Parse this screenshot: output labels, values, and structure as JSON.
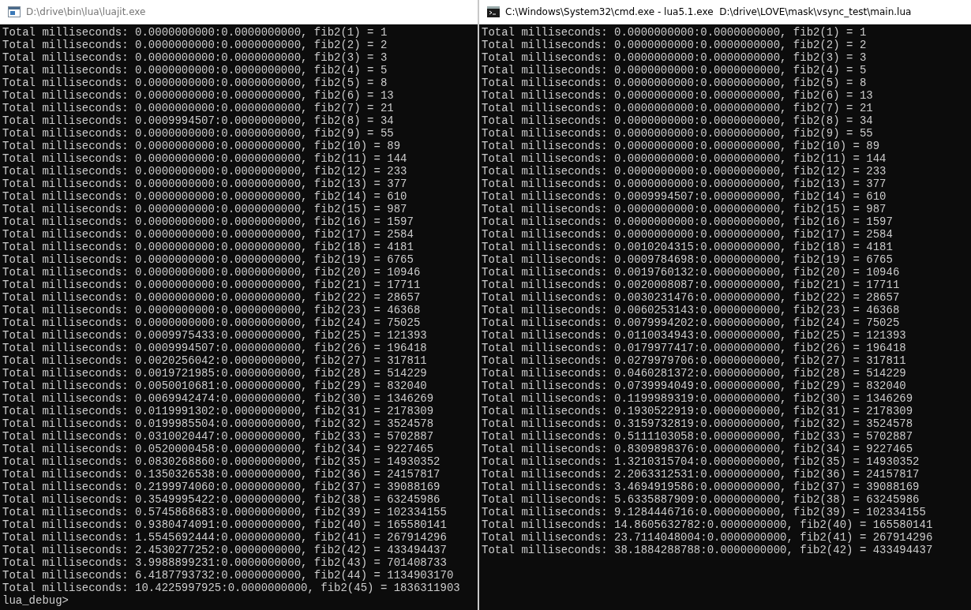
{
  "windows": [
    {
      "kind": "app",
      "title": "D:\\drive\\bin\\lua\\luajit.exe",
      "lines": [
        "Total milliseconds: 0.0000000000:0.0000000000, fib2(1) = 1",
        "Total milliseconds: 0.0000000000:0.0000000000, fib2(2) = 2",
        "Total milliseconds: 0.0000000000:0.0000000000, fib2(3) = 3",
        "Total milliseconds: 0.0000000000:0.0000000000, fib2(4) = 5",
        "Total milliseconds: 0.0000000000:0.0000000000, fib2(5) = 8",
        "Total milliseconds: 0.0000000000:0.0000000000, fib2(6) = 13",
        "Total milliseconds: 0.0000000000:0.0000000000, fib2(7) = 21",
        "Total milliseconds: 0.0009994507:0.0000000000, fib2(8) = 34",
        "Total milliseconds: 0.0000000000:0.0000000000, fib2(9) = 55",
        "Total milliseconds: 0.0000000000:0.0000000000, fib2(10) = 89",
        "Total milliseconds: 0.0000000000:0.0000000000, fib2(11) = 144",
        "Total milliseconds: 0.0000000000:0.0000000000, fib2(12) = 233",
        "Total milliseconds: 0.0000000000:0.0000000000, fib2(13) = 377",
        "Total milliseconds: 0.0000000000:0.0000000000, fib2(14) = 610",
        "Total milliseconds: 0.0000000000:0.0000000000, fib2(15) = 987",
        "Total milliseconds: 0.0000000000:0.0000000000, fib2(16) = 1597",
        "Total milliseconds: 0.0000000000:0.0000000000, fib2(17) = 2584",
        "Total milliseconds: 0.0000000000:0.0000000000, fib2(18) = 4181",
        "Total milliseconds: 0.0000000000:0.0000000000, fib2(19) = 6765",
        "Total milliseconds: 0.0000000000:0.0000000000, fib2(20) = 10946",
        "Total milliseconds: 0.0000000000:0.0000000000, fib2(21) = 17711",
        "Total milliseconds: 0.0000000000:0.0000000000, fib2(22) = 28657",
        "Total milliseconds: 0.0000000000:0.0000000000, fib2(23) = 46368",
        "Total milliseconds: 0.0000000000:0.0000000000, fib2(24) = 75025",
        "Total milliseconds: 0.0009975433:0.0000000000, fib2(25) = 121393",
        "Total milliseconds: 0.0009994507:0.0000000000, fib2(26) = 196418",
        "Total milliseconds: 0.0020256042:0.0000000000, fib2(27) = 317811",
        "Total milliseconds: 0.0019721985:0.0000000000, fib2(28) = 514229",
        "Total milliseconds: 0.0050010681:0.0000000000, fib2(29) = 832040",
        "Total milliseconds: 0.0069942474:0.0000000000, fib2(30) = 1346269",
        "Total milliseconds: 0.0119991302:0.0000000000, fib2(31) = 2178309",
        "Total milliseconds: 0.0199985504:0.0000000000, fib2(32) = 3524578",
        "Total milliseconds: 0.0310020447:0.0000000000, fib2(33) = 5702887",
        "Total milliseconds: 0.0520000458:0.0000000000, fib2(34) = 9227465",
        "Total milliseconds: 0.0830268860:0.0000000000, fib2(35) = 14930352",
        "Total milliseconds: 0.1350326538:0.0000000000, fib2(36) = 24157817",
        "Total milliseconds: 0.2199974060:0.0000000000, fib2(37) = 39088169",
        "Total milliseconds: 0.3549995422:0.0000000000, fib2(38) = 63245986",
        "Total milliseconds: 0.5745868683:0.0000000000, fib2(39) = 102334155",
        "Total milliseconds: 0.9380474091:0.0000000000, fib2(40) = 165580141",
        "Total milliseconds: 1.5545692444:0.0000000000, fib2(41) = 267914296",
        "Total milliseconds: 2.4530277252:0.0000000000, fib2(42) = 433494437",
        "Total milliseconds: 3.9988899231:0.0000000000, fib2(43) = 701408733",
        "Total milliseconds: 6.4187793732:0.0000000000, fib2(44) = 1134903170",
        "Total milliseconds: 10.4225997925:0.0000000000, fib2(45) = 1836311903",
        "lua_debug>"
      ]
    },
    {
      "kind": "cmd",
      "title": "C:\\Windows\\System32\\cmd.exe - lua5.1.exe  D:\\drive\\LOVE\\mask\\vsync_test\\main.lua",
      "lines": [
        "Total milliseconds: 0.0000000000:0.0000000000, fib2(1) = 1",
        "Total milliseconds: 0.0000000000:0.0000000000, fib2(2) = 2",
        "Total milliseconds: 0.0000000000:0.0000000000, fib2(3) = 3",
        "Total milliseconds: 0.0000000000:0.0000000000, fib2(4) = 5",
        "Total milliseconds: 0.0000000000:0.0000000000, fib2(5) = 8",
        "Total milliseconds: 0.0000000000:0.0000000000, fib2(6) = 13",
        "Total milliseconds: 0.0000000000:0.0000000000, fib2(7) = 21",
        "Total milliseconds: 0.0000000000:0.0000000000, fib2(8) = 34",
        "Total milliseconds: 0.0000000000:0.0000000000, fib2(9) = 55",
        "Total milliseconds: 0.0000000000:0.0000000000, fib2(10) = 89",
        "Total milliseconds: 0.0000000000:0.0000000000, fib2(11) = 144",
        "Total milliseconds: 0.0000000000:0.0000000000, fib2(12) = 233",
        "Total milliseconds: 0.0000000000:0.0000000000, fib2(13) = 377",
        "Total milliseconds: 0.0009994507:0.0000000000, fib2(14) = 610",
        "Total milliseconds: 0.0000000000:0.0000000000, fib2(15) = 987",
        "Total milliseconds: 0.0000000000:0.0000000000, fib2(16) = 1597",
        "Total milliseconds: 0.0000000000:0.0000000000, fib2(17) = 2584",
        "Total milliseconds: 0.0010204315:0.0000000000, fib2(18) = 4181",
        "Total milliseconds: 0.0009784698:0.0000000000, fib2(19) = 6765",
        "Total milliseconds: 0.0019760132:0.0000000000, fib2(20) = 10946",
        "Total milliseconds: 0.0020008087:0.0000000000, fib2(21) = 17711",
        "Total milliseconds: 0.0030231476:0.0000000000, fib2(22) = 28657",
        "Total milliseconds: 0.0060253143:0.0000000000, fib2(23) = 46368",
        "Total milliseconds: 0.0079994202:0.0000000000, fib2(24) = 75025",
        "Total milliseconds: 0.0110034943:0.0000000000, fib2(25) = 121393",
        "Total milliseconds: 0.0179977417:0.0000000000, fib2(26) = 196418",
        "Total milliseconds: 0.0279979706:0.0000000000, fib2(27) = 317811",
        "Total milliseconds: 0.0460281372:0.0000000000, fib2(28) = 514229",
        "Total milliseconds: 0.0739994049:0.0000000000, fib2(29) = 832040",
        "Total milliseconds: 0.1199989319:0.0000000000, fib2(30) = 1346269",
        "Total milliseconds: 0.1930522919:0.0000000000, fib2(31) = 2178309",
        "Total milliseconds: 0.3159732819:0.0000000000, fib2(32) = 3524578",
        "Total milliseconds: 0.5111103058:0.0000000000, fib2(33) = 5702887",
        "Total milliseconds: 0.8309898376:0.0000000000, fib2(34) = 9227465",
        "Total milliseconds: 1.3210315704:0.0000000000, fib2(35) = 14930352",
        "Total milliseconds: 2.2063312531:0.0000000000, fib2(36) = 24157817",
        "Total milliseconds: 3.4694919586:0.0000000000, fib2(37) = 39088169",
        "Total milliseconds: 5.6335887909:0.0000000000, fib2(38) = 63245986",
        "Total milliseconds: 9.1284446716:0.0000000000, fib2(39) = 102334155",
        "Total milliseconds: 14.8605632782:0.0000000000, fib2(40) = 165580141",
        "Total milliseconds: 23.7114048004:0.0000000000, fib2(41) = 267914296",
        "Total milliseconds: 38.1884288788:0.0000000000, fib2(42) = 433494437"
      ]
    }
  ]
}
